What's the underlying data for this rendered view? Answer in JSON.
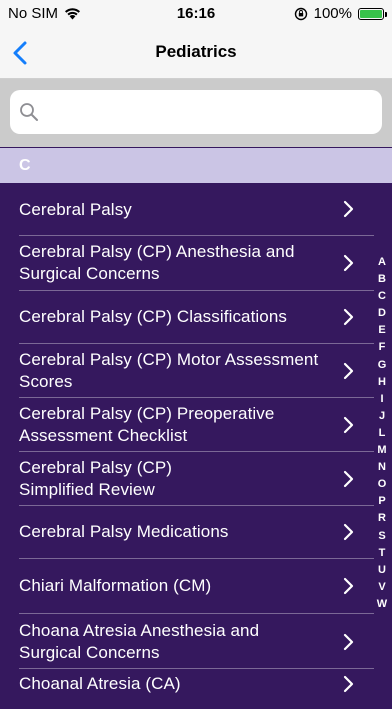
{
  "status": {
    "carrier": "No SIM",
    "time": "16:16",
    "battery": "100%"
  },
  "nav": {
    "title": "Pediatrics"
  },
  "search": {
    "placeholder": ""
  },
  "section": {
    "letter": "C"
  },
  "items": [
    "Cerebral Palsy",
    "Cerebral Palsy (CP) Anesthesia and Surgical Concerns",
    "Cerebral Palsy (CP) Classifications",
    "Cerebral Palsy (CP) Motor Assessment Scores",
    "Cerebral Palsy (CP) Preoperative Assessment Checklist",
    "Cerebral Palsy (CP) Simplified Review",
    "Cerebral Palsy Medications",
    "Chiari Malformation (CM)",
    "Choana Atresia Anesthesia and Surgical Concerns",
    "Choanal Atresia (CA)"
  ],
  "index": [
    "A",
    "B",
    "C",
    "D",
    "E",
    "F",
    "G",
    "H",
    "I",
    "J",
    "L",
    "M",
    "N",
    "O",
    "P",
    "R",
    "S",
    "T",
    "U",
    "V",
    "W"
  ],
  "colors": {
    "list_bg": "#35185e",
    "section_bg": "#cbc5e5",
    "accent": "#147efb"
  }
}
